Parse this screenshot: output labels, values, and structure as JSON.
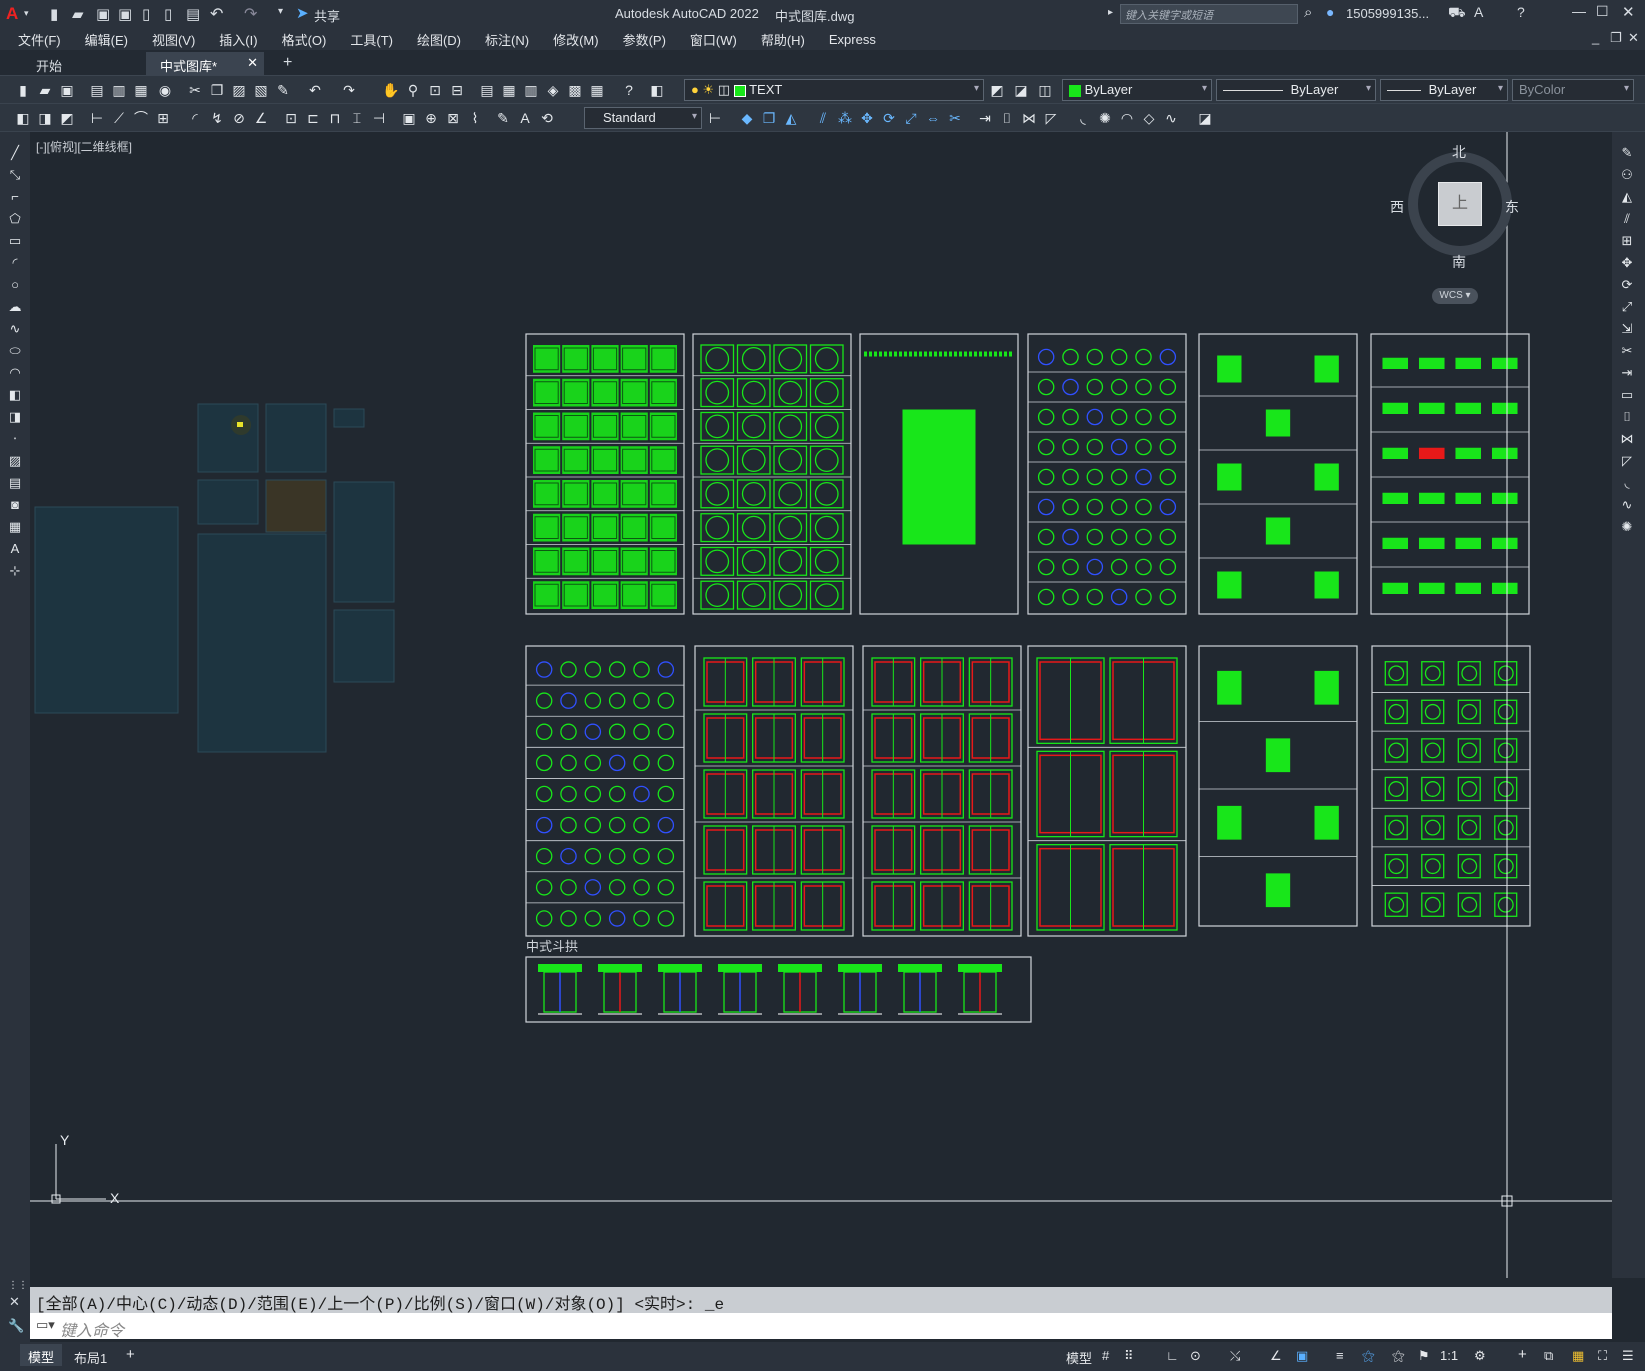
{
  "titlebar": {
    "app_title": "Autodesk AutoCAD 2022",
    "file_title": "中式图库.dwg",
    "share_label": "共享",
    "search_placeholder": "键入关键字或短语",
    "user_name": "1505999135..."
  },
  "menu": [
    "文件(F)",
    "编辑(E)",
    "视图(V)",
    "插入(I)",
    "格式(O)",
    "工具(T)",
    "绘图(D)",
    "标注(N)",
    "修改(M)",
    "参数(P)",
    "窗口(W)",
    "帮助(H)",
    "Express"
  ],
  "tabs": {
    "start": "开始",
    "active": "中式图库*"
  },
  "toolbar": {
    "layer": "TEXT",
    "color": "ByLayer",
    "linetype": "ByLayer",
    "lineweight": "ByLayer",
    "plotstyle": "ByColor",
    "textstyle": "Standard"
  },
  "viewport": {
    "label": "[-][俯视][二维线框]",
    "section_label": "中式斗拱"
  },
  "viewcube": {
    "north": "北",
    "south": "南",
    "east": "东",
    "west": "西",
    "top": "上",
    "wcs": "WCS"
  },
  "ucs": {
    "x": "X",
    "y": "Y"
  },
  "command": {
    "history": "[全部(A)/中心(C)/动态(D)/范围(E)/上一个(P)/比例(S)/窗口(W)/对象(O)] <实时>: _e",
    "placeholder": "键入命令"
  },
  "status": {
    "model_tab": "模型",
    "layout_tab": "布局1",
    "model_btn": "模型",
    "scale": "1:1"
  },
  "colors": {
    "green": "#18e61a",
    "red": "#e81919",
    "blue": "#3050ff",
    "background": "#212830"
  }
}
